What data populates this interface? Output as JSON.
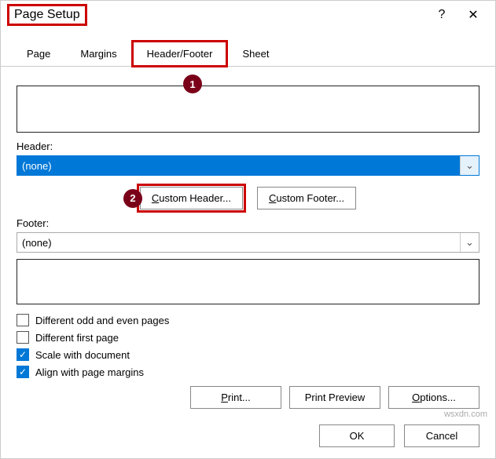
{
  "title": "Page Setup",
  "help_icon": "?",
  "close_icon": "✕",
  "tabs": {
    "page": "Page",
    "margins": "Margins",
    "header_footer": "Header/Footer",
    "sheet": "Sheet"
  },
  "markers": {
    "m1": "1",
    "m2": "2"
  },
  "labels": {
    "header": "Header:",
    "footer": "Footer:"
  },
  "selects": {
    "header_value": "(none)",
    "footer_value": "(none)"
  },
  "buttons": {
    "custom_header_pre": "C",
    "custom_header_rest": "ustom Header...",
    "custom_footer_pre": "C",
    "custom_footer_rest": "ustom Footer...",
    "print_pre": "P",
    "print_rest": "rint...",
    "print_preview": "Print Preview",
    "options_pre": "O",
    "options_rest": "ptions...",
    "ok": "OK",
    "cancel": "Cancel"
  },
  "checks": {
    "diff_odd_even_pre": "D",
    "diff_odd_even_rest": "ifferent odd and even pages",
    "diff_first_pre": "D",
    "diff_first_mid": "ifferent first page",
    "scale_pre": "Sca",
    "scale_u": "l",
    "scale_rest": "e with document",
    "align_pre": "Align with page ",
    "align_u": "m",
    "align_rest": "argins"
  },
  "watermark": "wsxdn.com",
  "arrow": "⌄"
}
